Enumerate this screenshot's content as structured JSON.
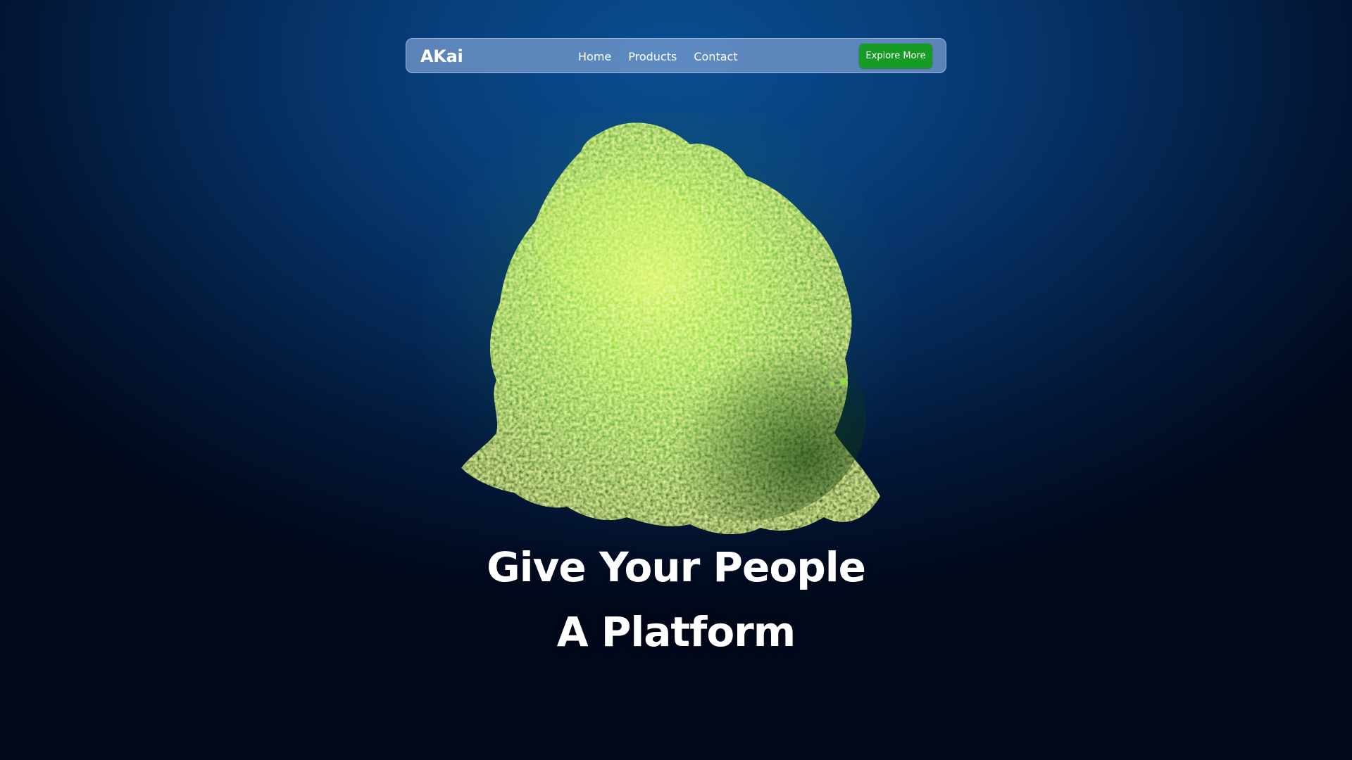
{
  "navbar": {
    "brand": "AKai",
    "links": [
      {
        "label": "Home"
      },
      {
        "label": "Products"
      },
      {
        "label": "Contact"
      }
    ],
    "cta_label": "Explore More"
  },
  "hero": {
    "title_line_1": "Give Your People",
    "title_line_2": "A Platform",
    "image_subject": "green-particle-sphere"
  },
  "colors": {
    "background": "#052d5e",
    "accent_green": "#169b25",
    "navbar_glass": "#92b0de"
  }
}
